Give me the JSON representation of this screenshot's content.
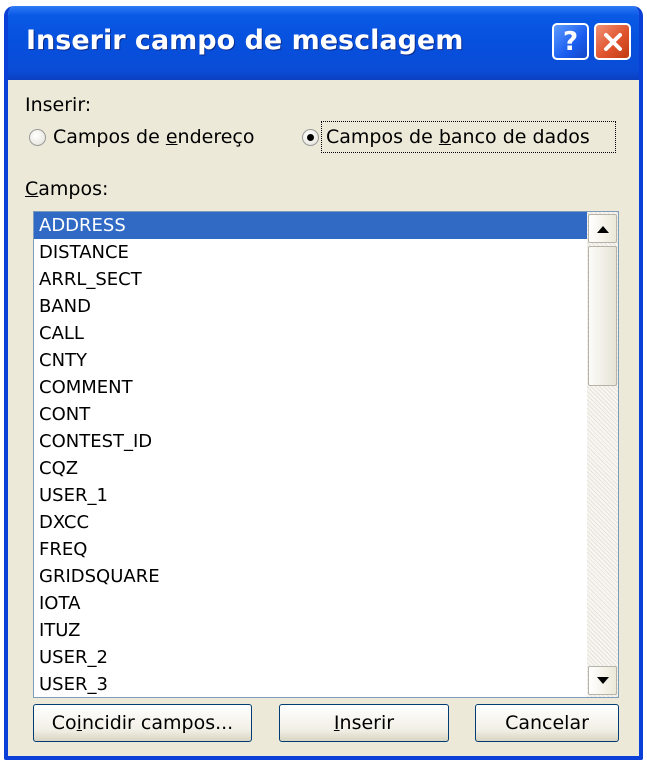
{
  "dialog": {
    "title": "Inserir campo de mesclagem",
    "help_icon": "?",
    "close_icon": "close-x"
  },
  "insert_group": {
    "label": "Inserir:",
    "options": [
      {
        "pre": "Campos de ",
        "ul": "e",
        "post": "ndereço",
        "selected": false
      },
      {
        "pre": "Campos de ",
        "ul": "b",
        "post": "anco de dados",
        "selected": true
      }
    ]
  },
  "fields": {
    "label_ul": "C",
    "label_rest": "ampos:",
    "selected_index": 0,
    "items": [
      "ADDRESS",
      "DISTANCE",
      "ARRL_SECT",
      "BAND",
      "CALL",
      "CNTY",
      "COMMENT",
      "CONT",
      "CONTEST_ID",
      "CQZ",
      "USER_1",
      "DXCC",
      "FREQ",
      "GRIDSQUARE",
      "IOTA",
      "ITUZ",
      "USER_2",
      "USER_3"
    ]
  },
  "buttons": {
    "match": {
      "pre": "Co",
      "ul": "i",
      "post": "ncidir campos..."
    },
    "insert": {
      "pre": "",
      "ul": "I",
      "post": "nserir"
    },
    "cancel": {
      "pre": "Cancelar",
      "ul": "",
      "post": ""
    }
  },
  "colors": {
    "titlebar": "#0650dd",
    "selection": "#316ac5",
    "dialog_bg": "#ece9d8"
  }
}
